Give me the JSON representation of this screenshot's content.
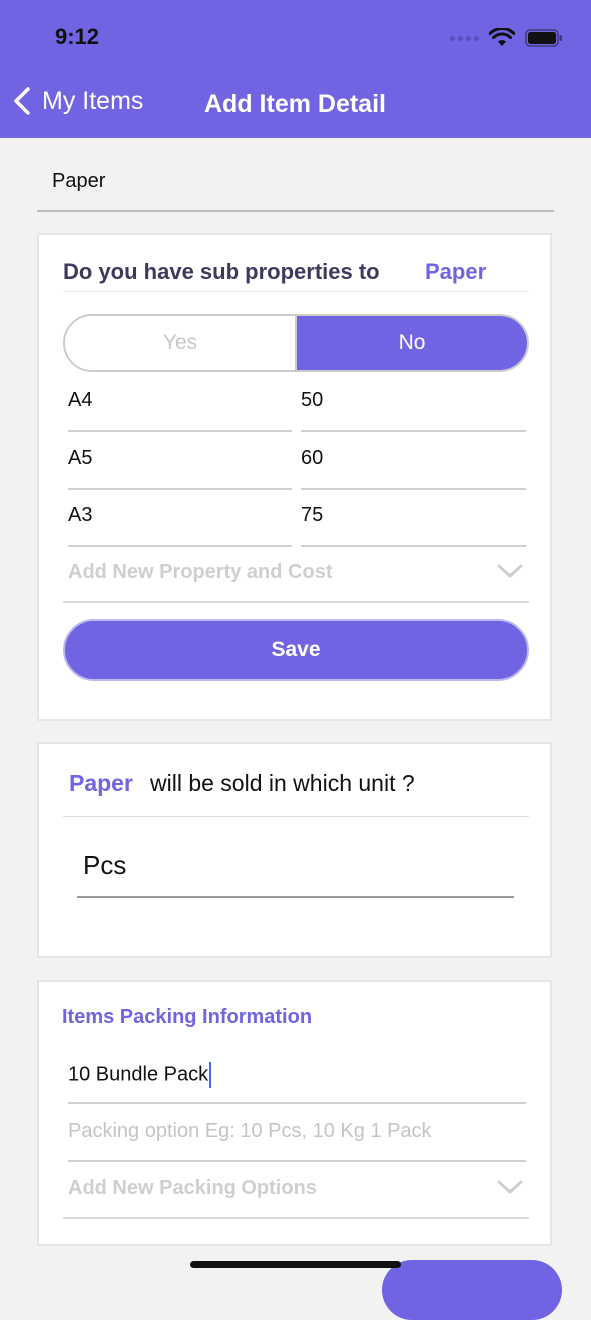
{
  "status": {
    "time": "9:12"
  },
  "nav": {
    "back_label": "My Items",
    "title": "Add Item Detail"
  },
  "item": {
    "name": "Paper"
  },
  "sub_properties": {
    "question": "Do you have sub properties to",
    "item_name": "Paper",
    "toggle": {
      "yes_label": "Yes",
      "no_label": "No",
      "selected": "No"
    },
    "rows": [
      {
        "name": "A4",
        "cost": "50"
      },
      {
        "name": "A5",
        "cost": "60"
      },
      {
        "name": "A3",
        "cost": "75"
      }
    ],
    "add_label": "Add New Property and Cost",
    "save_label": "Save"
  },
  "unit": {
    "item_name": "Paper",
    "question": "will be sold in which unit ?",
    "value": "Pcs"
  },
  "packing": {
    "title": "Items Packing Information",
    "current_value": "10 Bundle Pack",
    "placeholder": "Packing option Eg: 10 Pcs, 10 Kg 1 Pack",
    "add_label": "Add New Packing Options"
  },
  "colors": {
    "accent": "#7064e2",
    "background": "#f2f2f2"
  }
}
